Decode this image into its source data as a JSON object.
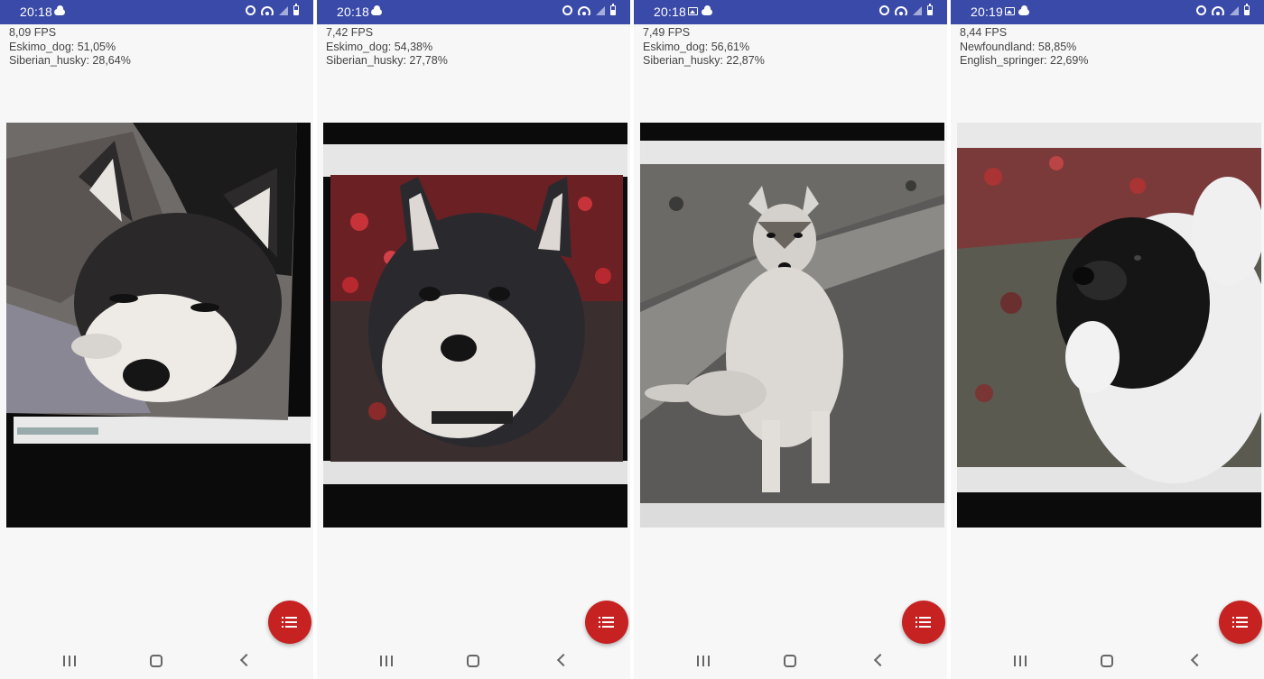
{
  "screens": [
    {
      "status_time": "20:18",
      "status_icons": [
        "cloud-icon"
      ],
      "fps": "8,09 FPS",
      "results": [
        "Eskimo_dog: 51,05%",
        "Siberian_husky: 28,64%"
      ]
    },
    {
      "status_time": "20:18",
      "status_icons": [
        "cloud-icon"
      ],
      "fps": "7,42 FPS",
      "results": [
        "Eskimo_dog: 54,38%",
        "Siberian_husky: 27,78%"
      ]
    },
    {
      "status_time": "20:18",
      "status_icons": [
        "gallery-icon",
        "cloud-icon"
      ],
      "fps": "7,49 FPS",
      "results": [
        "Eskimo_dog: 56,61%",
        "Siberian_husky: 22,87%"
      ]
    },
    {
      "status_time": "20:19",
      "status_icons": [
        "gallery-icon",
        "cloud-icon"
      ],
      "fps": "8,44 FPS",
      "results": [
        "Newfoundland: 58,85%",
        "English_springer: 22,69%"
      ]
    }
  ],
  "camera_subjects": [
    "husky-lying-photo",
    "husky-closeup-photo",
    "husky-sitting-photo",
    "newfoundland-photo"
  ],
  "colors": {
    "status_bar": "#3a4aa8",
    "fab": "#c62222",
    "background": "#f7f7f7",
    "text": "#444444"
  }
}
